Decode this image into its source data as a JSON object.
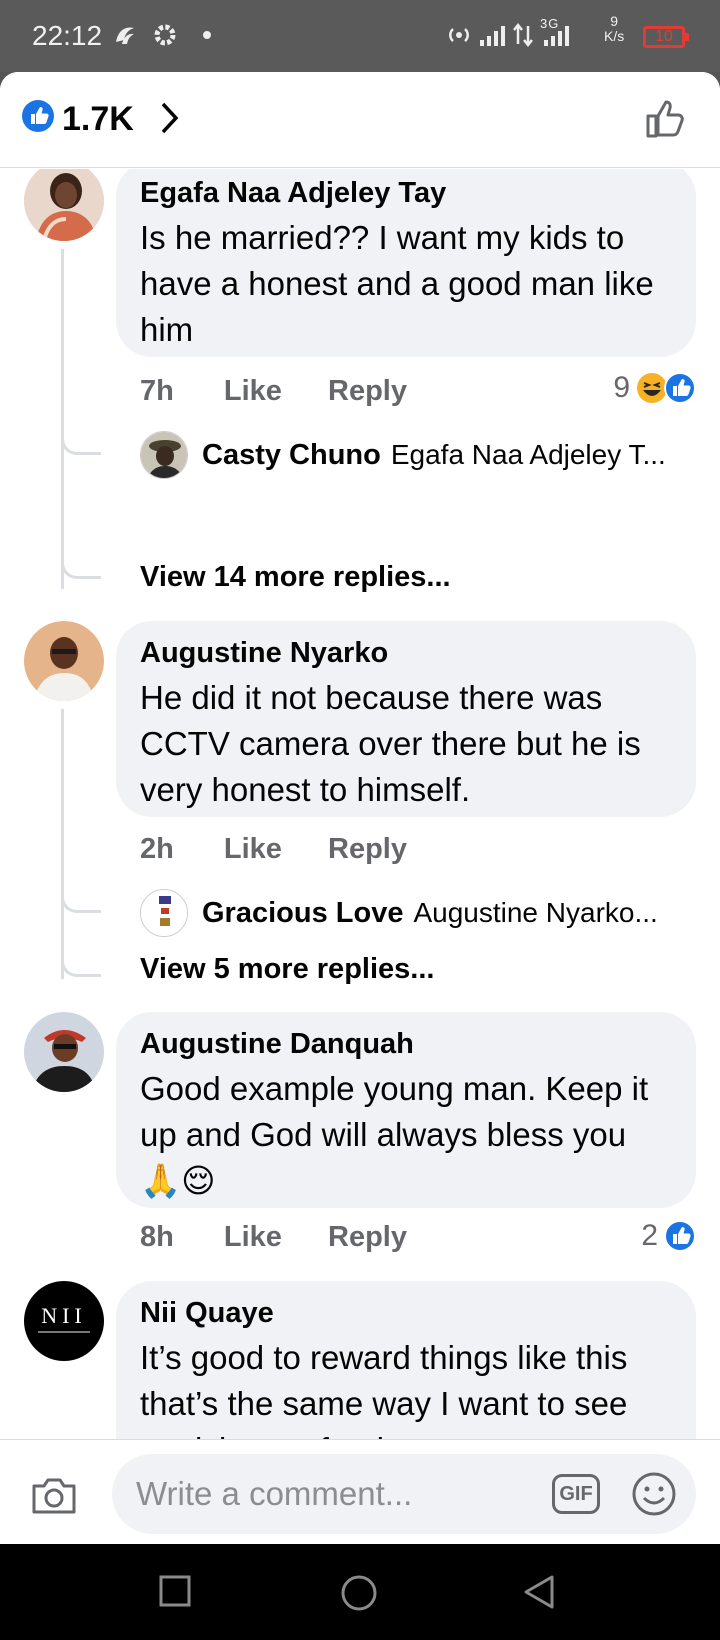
{
  "status_bar": {
    "time": "22:12",
    "network": "3G",
    "speed_value": "9",
    "speed_unit": "K/s",
    "battery": "10"
  },
  "header": {
    "like_count": "1.7K"
  },
  "comments": [
    {
      "author": "Egafa Naa Adjeley Tay",
      "text": "Is he married?? I want my kids to have a honest and a good man like him",
      "time": "7h",
      "like": "Like",
      "reply": "Reply",
      "reactions": "9",
      "reply_preview": {
        "author": "Casty Chuno",
        "text": "Egafa Naa Adjeley T..."
      },
      "more_replies": "View 14 more replies..."
    },
    {
      "author": "Augustine Nyarko",
      "text": "He did it not because there was CCTV camera  over there but he is very honest to himself.",
      "time": "2h",
      "like": "Like",
      "reply": "Reply",
      "reply_preview": {
        "author": "Gracious Love",
        "text": "Augustine Nyarko..."
      },
      "more_replies": "View 5 more replies..."
    },
    {
      "author": "Augustine Danquah",
      "text": "Good example young man. Keep it up and God will always bless you 🙏😌",
      "time": "8h",
      "like": "Like",
      "reply": "Reply",
      "reactions": "2"
    },
    {
      "author": "Nii Quaye",
      "text": "It’s good to reward things like this that’s the same way I want to see punishment for those",
      "avatar_text": "NII"
    }
  ],
  "composer": {
    "placeholder": "Write a comment...",
    "gif_label": "GIF"
  },
  "colors": {
    "facebook_blue": "#1b74e4",
    "haha_yellow": "#f7b125",
    "bubble_bg": "#f0f2f5",
    "meta_gray": "#65676b"
  }
}
